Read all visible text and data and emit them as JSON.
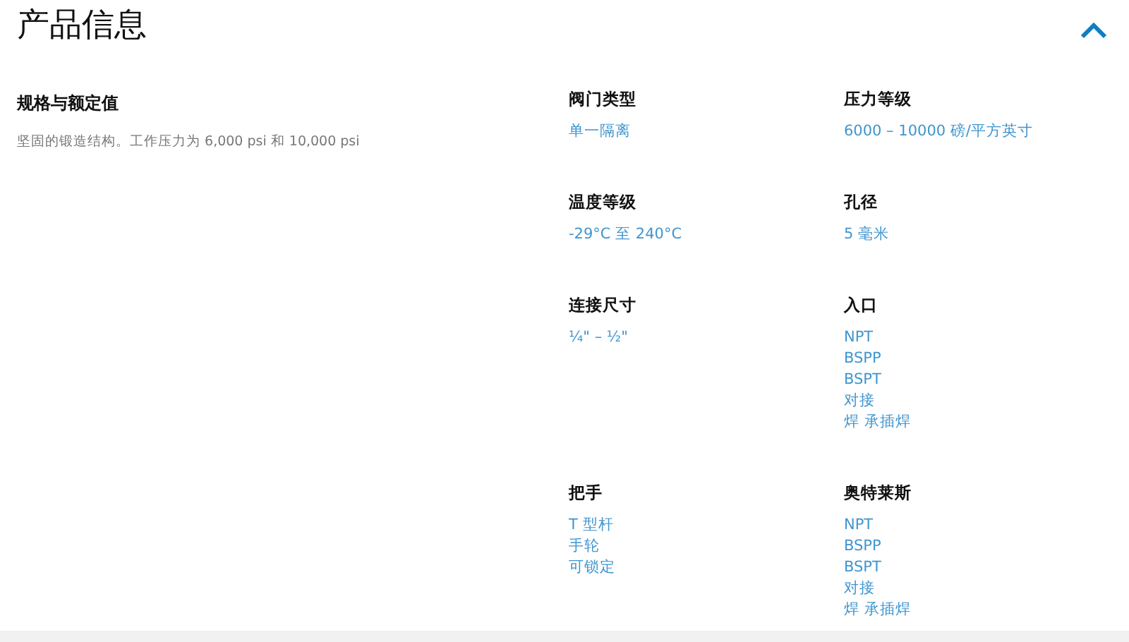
{
  "section": {
    "title": "产品信息",
    "expanded": true
  },
  "specs_intro": {
    "heading": "规格与额定值",
    "description": "坚固的锻造结构。工作压力为 6,000 psi 和 10,000 psi"
  },
  "specs": [
    {
      "label": "阀门类型",
      "values": [
        "单一隔离"
      ]
    },
    {
      "label": "压力等级",
      "values": [
        "6000 – 10000 磅/平方英寸"
      ]
    },
    {
      "label": "温度等级",
      "values": [
        "-29°C 至 240°C"
      ]
    },
    {
      "label": "孔径",
      "values": [
        "5 毫米"
      ]
    },
    {
      "label": "连接尺寸",
      "values": [
        "¼\" – ½\""
      ]
    },
    {
      "label": "入口",
      "values": [
        "NPT",
        "BSPP",
        "BSPT",
        "对接",
        "焊 承插焊"
      ]
    },
    {
      "label": "把手",
      "values": [
        "T 型杆",
        "手轮",
        "可锁定"
      ]
    },
    {
      "label": "奥特莱斯",
      "values": [
        "NPT",
        "BSPP",
        "BSPT",
        "对接",
        "焊 承插焊"
      ]
    }
  ]
}
